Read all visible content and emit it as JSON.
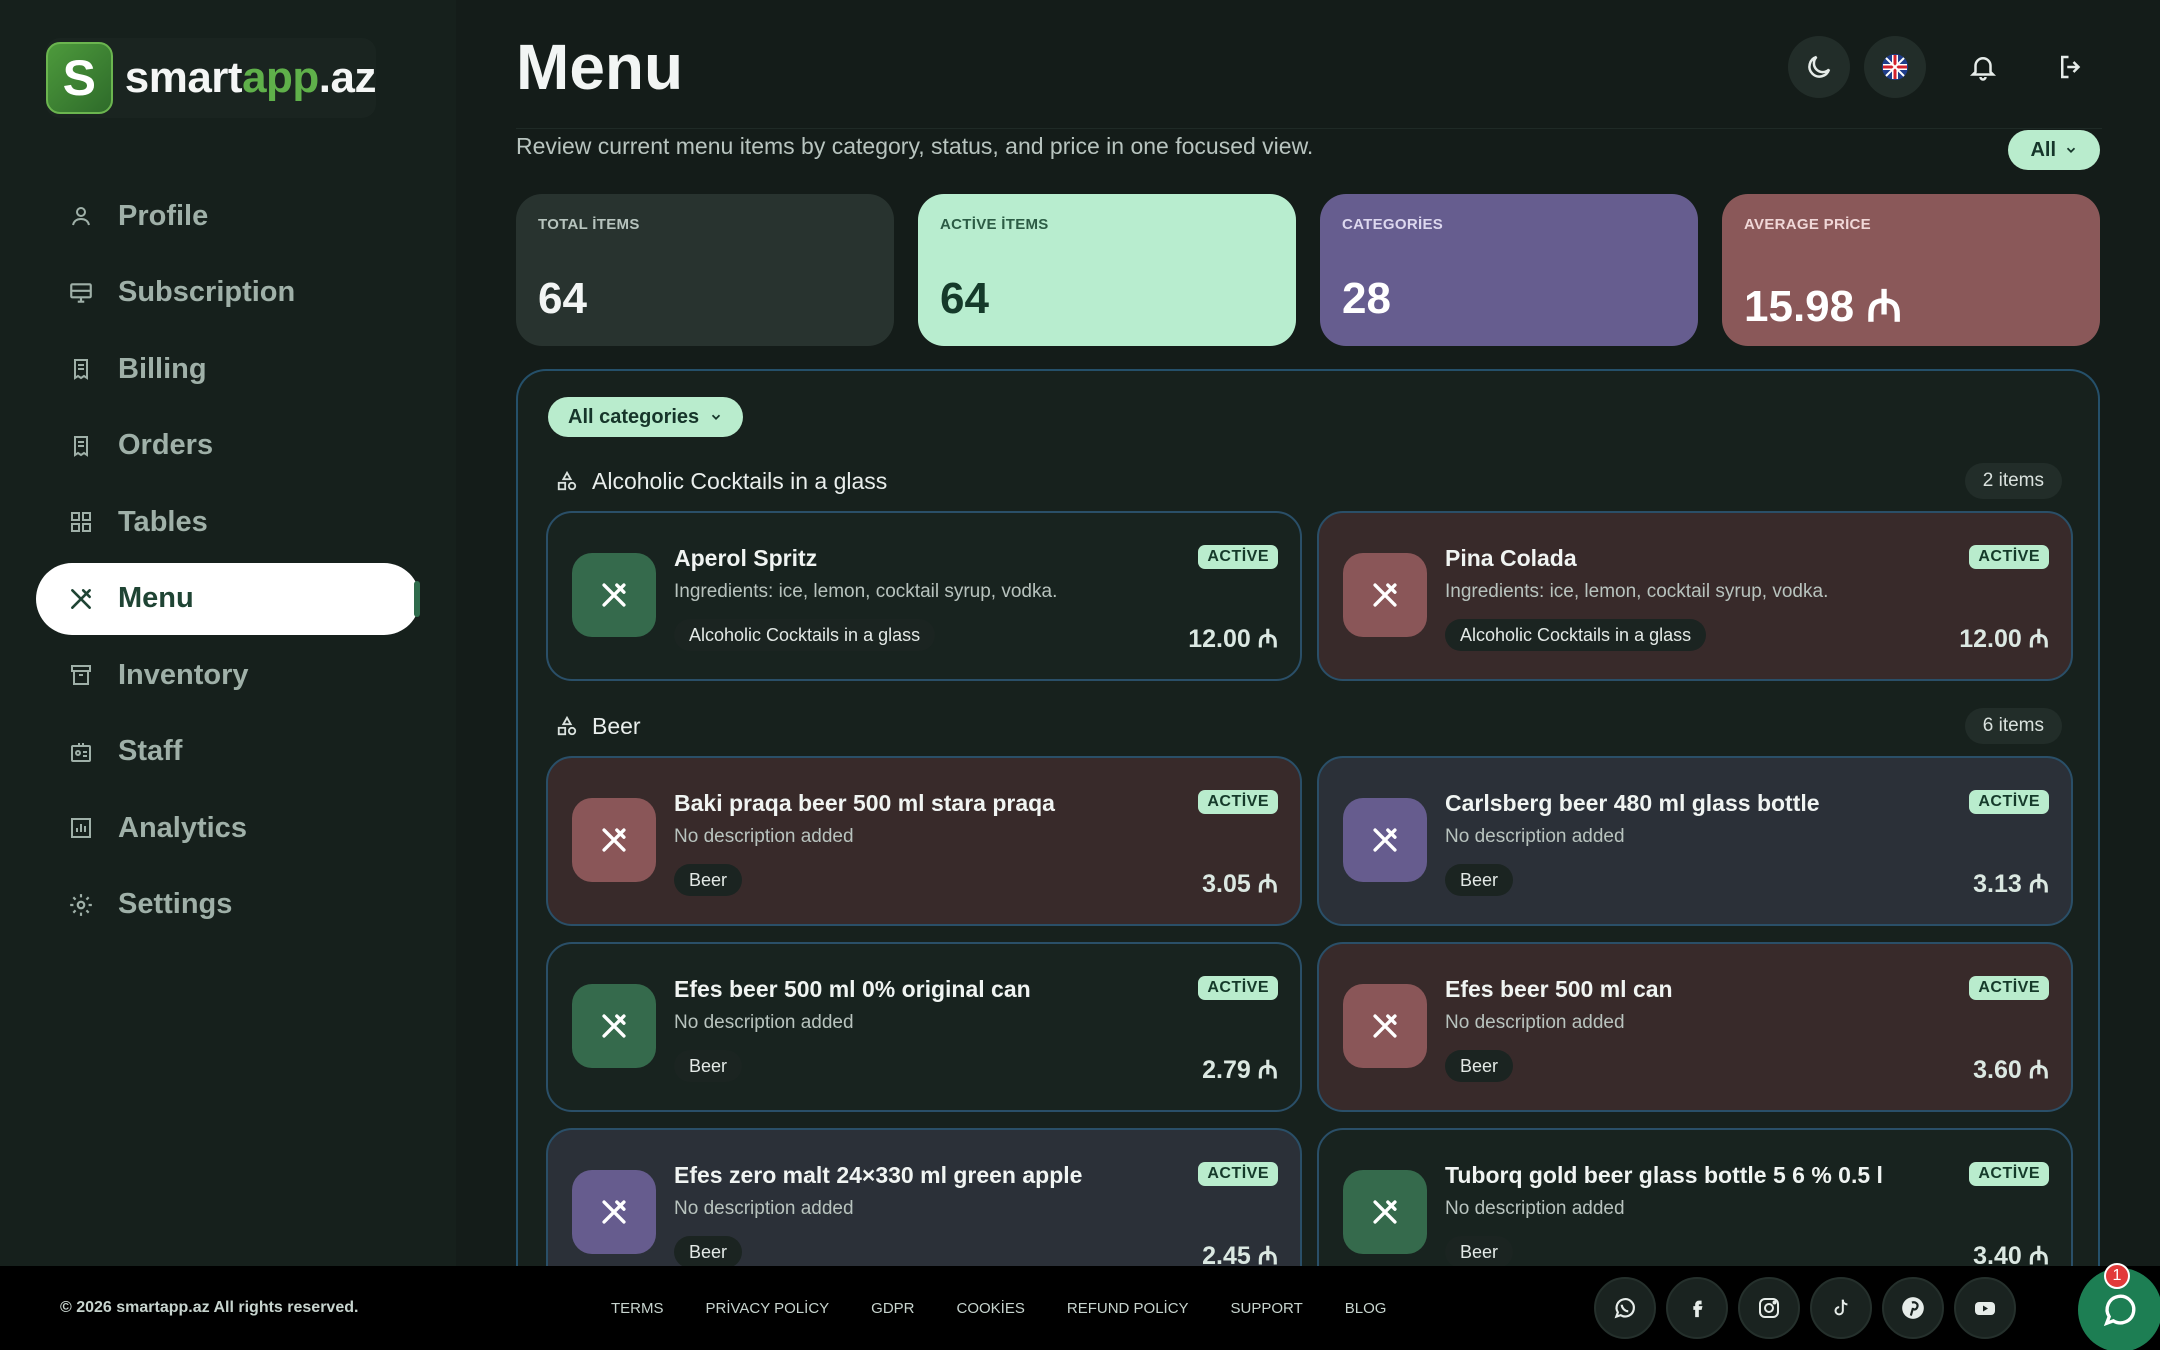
{
  "brand": {
    "prefix": "smart",
    "accent": "app",
    "suffix": ".az",
    "badge_letter": "S"
  },
  "sidebar": {
    "items": [
      {
        "label": "Profile",
        "icon": "user-icon"
      },
      {
        "label": "Subscription",
        "icon": "monitor-icon"
      },
      {
        "label": "Billing",
        "icon": "receipt-icon"
      },
      {
        "label": "Orders",
        "icon": "receipt-icon"
      },
      {
        "label": "Tables",
        "icon": "grid-icon"
      },
      {
        "label": "Menu",
        "icon": "utensils-icon",
        "active": true
      },
      {
        "label": "Inventory",
        "icon": "archive-icon"
      },
      {
        "label": "Staff",
        "icon": "id-card-icon"
      },
      {
        "label": "Analytics",
        "icon": "chart-icon"
      },
      {
        "label": "Settings",
        "icon": "gear-icon"
      }
    ]
  },
  "header": {
    "title": "Menu",
    "description": "Review current menu items by category, status, and price in one focused view.",
    "filter": "All"
  },
  "stats": [
    {
      "label": "TOTAL İTEMS",
      "value": "64"
    },
    {
      "label": "ACTİVE İTEMS",
      "value": "64"
    },
    {
      "label": "CATEGORİES",
      "value": "28"
    },
    {
      "label": "AVERAGE PRİCE",
      "value": "15.98 ₼"
    }
  ],
  "category_filter": "All categories",
  "sections": [
    {
      "title": "Alcoholic Cocktails in a glass",
      "count": "2 items"
    },
    {
      "title": "Beer",
      "count": "6 items"
    }
  ],
  "items": [
    {
      "name": "Aperol Spritz",
      "desc": "Ingredients: ice, lemon, cocktail syrup, vodka.",
      "tag": "Alcoholic Cocktails in a glass",
      "status": "ACTİVE",
      "price": "12.00 ₼"
    },
    {
      "name": "Pina Colada",
      "desc": "Ingredients: ice, lemon, cocktail syrup, vodka.",
      "tag": "Alcoholic Cocktails in a glass",
      "status": "ACTİVE",
      "price": "12.00 ₼"
    },
    {
      "name": "Baki praqa beer 500 ml stara praqa",
      "desc": "No description added",
      "tag": "Beer",
      "status": "ACTİVE",
      "price": "3.05 ₼"
    },
    {
      "name": "Carlsberg beer 480 ml glass bottle",
      "desc": "No description added",
      "tag": "Beer",
      "status": "ACTİVE",
      "price": "3.13 ₼"
    },
    {
      "name": "Efes beer 500 ml 0% original can",
      "desc": "No description added",
      "tag": "Beer",
      "status": "ACTİVE",
      "price": "2.79 ₼"
    },
    {
      "name": "Efes beer 500 ml can",
      "desc": "No description added",
      "tag": "Beer",
      "status": "ACTİVE",
      "price": "3.60 ₼"
    },
    {
      "name": "Efes zero malt 24×330 ml green apple",
      "desc": "No description added",
      "tag": "Beer",
      "status": "ACTİVE",
      "price": "2.45 ₼"
    },
    {
      "name": "Tuborq gold beer glass bottle 5 6 % 0.5 l",
      "desc": "No description added",
      "tag": "Beer",
      "status": "ACTİVE",
      "price": "3.40 ₼"
    }
  ],
  "footer": {
    "copyright": "© 2026 smartapp.az All rights reserved.",
    "links": [
      "TERMS",
      "PRİVACY POLİCY",
      "GDPR",
      "COOKİES",
      "REFUND POLİCY",
      "SUPPORT",
      "BLOG"
    ],
    "socials": [
      "whatsapp-icon",
      "facebook-icon",
      "instagram-icon",
      "tiktok-icon",
      "pinterest-icon",
      "youtube-icon"
    ],
    "chat_badge": "1"
  },
  "colors": {
    "accent": "#b9eccd",
    "brand_green": "#5fb04a",
    "border": "#25506a"
  }
}
